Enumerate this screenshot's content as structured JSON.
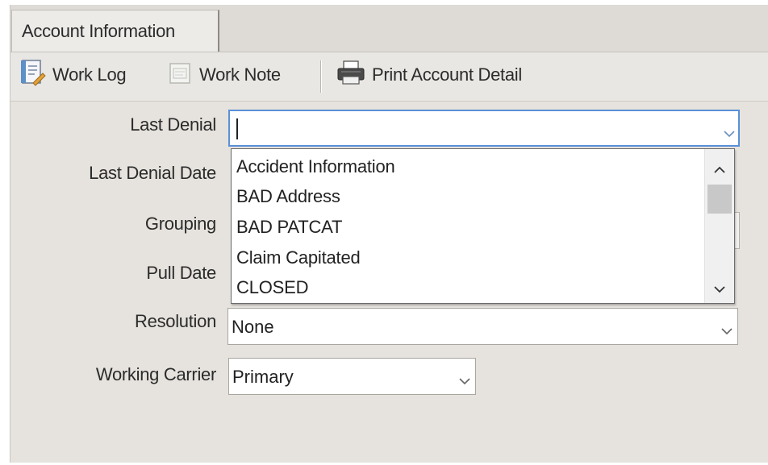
{
  "tabs": [
    {
      "label": "Account Information"
    }
  ],
  "toolbar": {
    "work_log": "Work Log",
    "work_note": "Work Note",
    "print_detail": "Print Account Detail"
  },
  "form": {
    "last_denial_label": "Last Denial",
    "last_denial_value": "",
    "last_denial_date_label": "Last Denial Date",
    "grouping_label": "Grouping",
    "pull_date_label": "Pull Date",
    "resolution_label": "Resolution",
    "resolution_value": "None",
    "working_carrier_label": "Working Carrier",
    "working_carrier_value": "Primary"
  },
  "dropdown": {
    "options": [
      "Accident Information",
      "BAD Address",
      "BAD PATCAT",
      "Claim Capitated",
      "CLOSED"
    ]
  }
}
